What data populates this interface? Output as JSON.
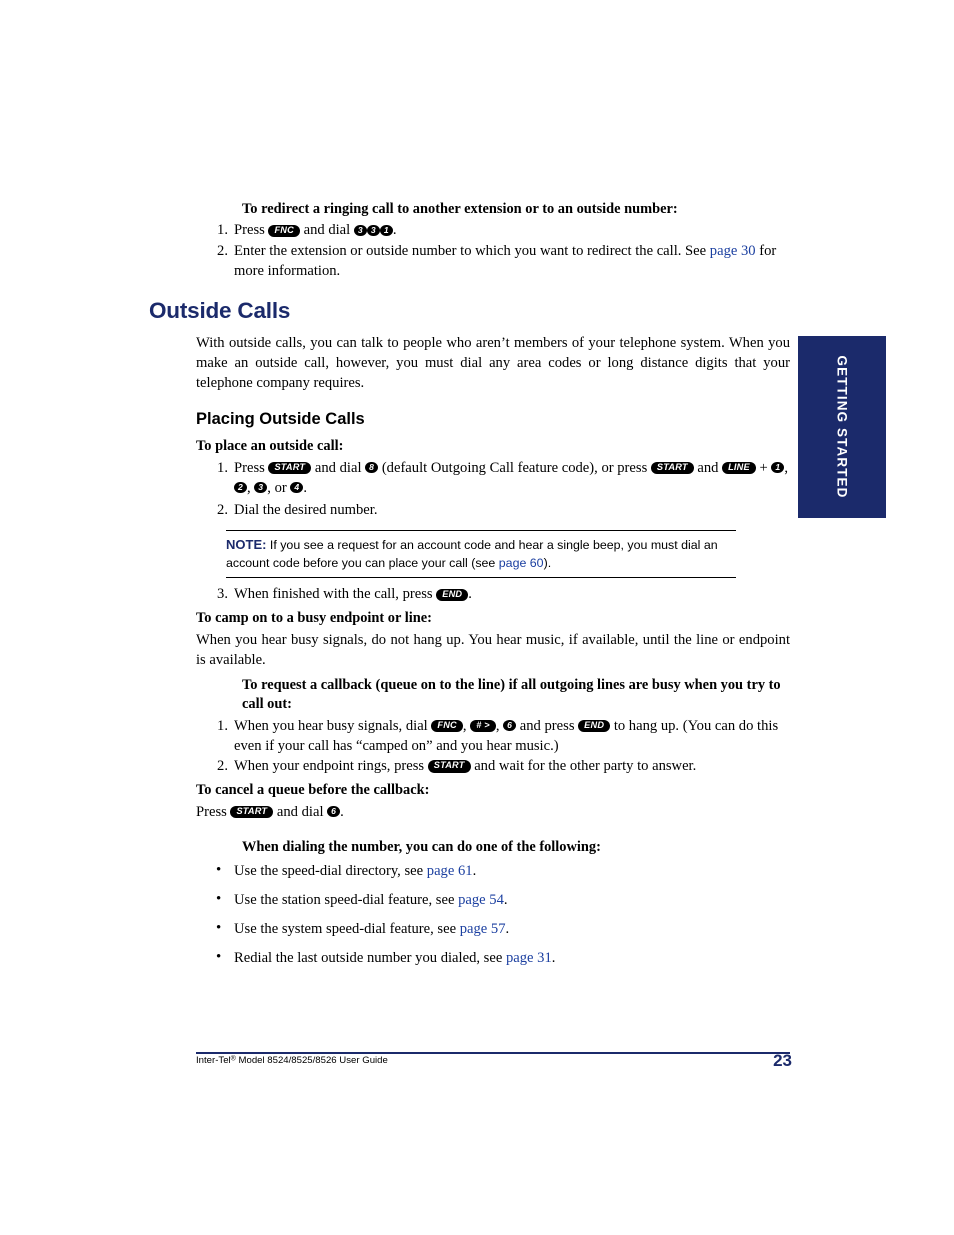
{
  "side_tab": {
    "label": "GETTING STARTED"
  },
  "content": {
    "redirect_heading": "To redirect a ringing call to another extension or to an outside number:",
    "redirect_steps": [
      {
        "num": "1.",
        "pre": "Press",
        "keys": [
          "FNC"
        ],
        "mid": "and dial",
        "digits": [
          "3",
          "3",
          "1"
        ],
        "post": "."
      },
      {
        "num": "2.",
        "text_a": "Enter the extension or outside number to which you want to redirect the call. See",
        "link": "page 30",
        "text_b": "for more information."
      }
    ],
    "section_title": "Outside Calls",
    "section_body": "With outside calls, you can talk to people who aren’t members of your telephone system. When you make an outside call, however, you must dial any area codes or long distance digits that your telephone company requires.",
    "subsection_title": "Placing Outside Calls",
    "place_heading": "To place an outside call:",
    "place_step1": {
      "num": "1.",
      "pre": "Press",
      "key_start": "START",
      "mid1": "and dial",
      "key_8": "8",
      "mid2": "(default Outgoing Call feature code), or press",
      "key_start2": "START",
      "mid3": "and",
      "key_line": "LINE",
      "plus": "+",
      "key_1": "1",
      "comma1": ",",
      "key_2": "2",
      "comma2": ",",
      "key_3": "3",
      "or": ", or",
      "key_4": "4",
      "post": "."
    },
    "place_step2": {
      "num": "2.",
      "text": "Dial the desired number."
    },
    "note": {
      "label": "NOTE:",
      "text_a": "If you see a request for an account code and hear a single beep, you must dial an account code before you can place your call (see",
      "link": "page 60",
      "text_b": ")."
    },
    "place_step3": {
      "num": "3.",
      "pre": "When finished with the call, press",
      "key_end": "END",
      "post": "."
    },
    "camp_heading": "To camp on to a busy endpoint or line:",
    "camp_body": "When you hear busy signals, do not hang up. You hear music, if available, until the line or endpoint is available.",
    "callback_heading": "To request a callback (queue on to the line) if all outgoing lines are busy when you try to call out:",
    "callback_step1": {
      "num": "1.",
      "pre": "When you hear busy signals, dial",
      "key_fnc": "FNC",
      "comma1": ",",
      "key_hash": "# >",
      "comma2": ",",
      "key_6": "6",
      "mid": "and press",
      "key_end": "END",
      "post": "to hang up. (You can do this even if your call has “camped on” and you hear music.)"
    },
    "callback_step2": {
      "num": "2.",
      "pre": "When your endpoint rings, press",
      "key_start": "START",
      "post": "and wait for the other party to answer."
    },
    "cancel_heading": "To cancel a queue before the callback:",
    "cancel_body": {
      "pre": "Press",
      "key_start": "START",
      "mid": "and dial",
      "key_6": "6",
      "post": "."
    },
    "dialing_heading": "When dialing the number, you can do one of the following:",
    "dialing_items": [
      {
        "text_a": "Use the speed-dial directory, see",
        "link": "page 61",
        "text_b": "."
      },
      {
        "text_a": "Use the station speed-dial feature, see",
        "link": "page 54",
        "text_b": "."
      },
      {
        "text_a": "Use the system speed-dial feature, see",
        "link": "page 57",
        "text_b": "."
      },
      {
        "text_a": "Redial the last outside number you dialed, see",
        "link": "page 31",
        "text_b": "."
      }
    ]
  },
  "footer": {
    "left_a": "Inter-Tel",
    "left_sup": "®",
    "left_b": " Model 8524/8525/8526 User Guide",
    "page_number": "23"
  },
  "colors": {
    "accent": "#1b2a6b",
    "link": "#1b3fa0"
  }
}
